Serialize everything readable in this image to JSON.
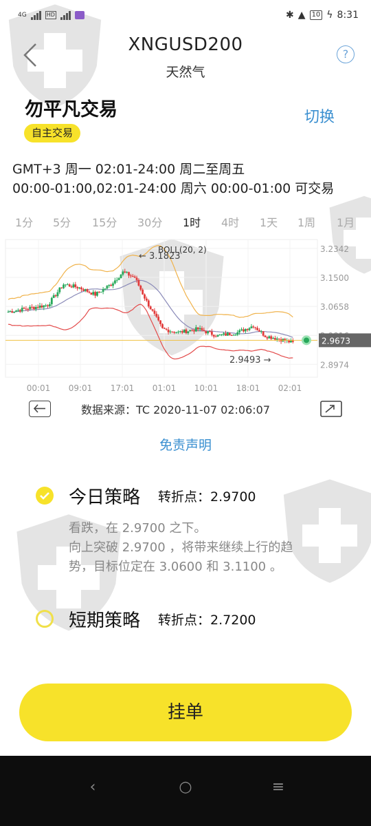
{
  "status_bar": {
    "network": "4G",
    "hd": "HD",
    "battery": "10",
    "time": "8:31"
  },
  "header": {
    "symbol": "XNGUSD200",
    "name": "天然气",
    "help": "?"
  },
  "strategy": {
    "name": "勿平凡交易",
    "switch_label": "切换",
    "badge": "自主交易"
  },
  "trading_hours": {
    "line1": "GMT+3 周一 02:01-24:00  周二至周五",
    "line2": "00:00-01:00,02:01-24:00  周六 00:00-01:00 可交易"
  },
  "timeframes": {
    "items": [
      "1分",
      "5分",
      "15分",
      "30分",
      "1时",
      "4时",
      "1天",
      "1周",
      "1月"
    ],
    "selected": "1时"
  },
  "chart_data": {
    "type": "candlestick",
    "indicator": "BOLL(20, 2)",
    "y_ticks": [
      "3.2342",
      "3.1500",
      "3.0658",
      "2.9816",
      "2.8974"
    ],
    "ylim": [
      2.86,
      3.26
    ],
    "x_ticks": [
      "00:01",
      "09:01",
      "17:01",
      "01:01",
      "10:01",
      "18:01",
      "02:01"
    ],
    "high_marker": "← 3.1823",
    "low_marker": "2.9493 →",
    "last_price": "2.9673",
    "colors": {
      "up": "#27a85a",
      "down": "#e23b3b",
      "upper_band": "#f0b24a",
      "lower_band": "#e34a4a",
      "mid_band": "#8a8ab8",
      "last_line": "#f0c040"
    }
  },
  "chart_footer": {
    "source": "数据来源：TC   2020-11-07 02:06:07"
  },
  "disclaimer": "免责声明",
  "plans": [
    {
      "title": "今日策略",
      "pivot": "转折点：2.9700",
      "selected": true,
      "lines": [
        "看跌，在 2.9700 之下。",
        "向上突破 2.9700 ，将带来继续上行的趋",
        "势，目标位定在 3.0600 和 3.1100 。"
      ]
    },
    {
      "title": "短期策略",
      "pivot": "转折点：2.7200",
      "selected": false,
      "lines": []
    }
  ],
  "order_button": "挂单",
  "nav": {
    "back": "‹",
    "home": "○",
    "menu": "≡"
  }
}
